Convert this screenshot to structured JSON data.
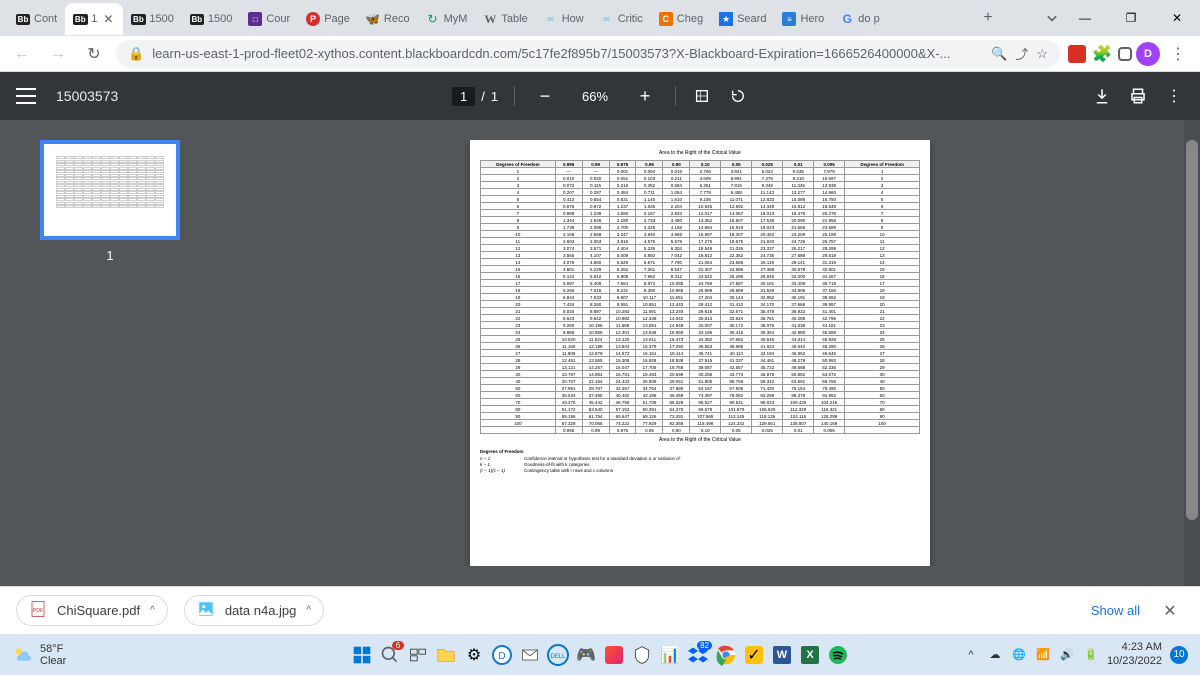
{
  "window": {
    "minimize": "—",
    "maximize": "❐",
    "close": "✕"
  },
  "tabs": {
    "items": [
      {
        "icon": "bb",
        "label": "Cont"
      },
      {
        "icon": "bb",
        "label": "1",
        "active": true,
        "closeable": true
      },
      {
        "icon": "bb",
        "label": "1500"
      },
      {
        "icon": "bb",
        "label": "1500"
      },
      {
        "icon": "quiz",
        "label": "Cour"
      },
      {
        "icon": "P",
        "label": "Page"
      },
      {
        "icon": "reco",
        "label": "Reco"
      },
      {
        "icon": "mym",
        "label": "MyM"
      },
      {
        "icon": "W",
        "label": "Table"
      },
      {
        "icon": "how",
        "label": "How"
      },
      {
        "icon": "how",
        "label": "Critic"
      },
      {
        "icon": "C",
        "label": "Cheg"
      },
      {
        "icon": "star",
        "label": "Seard"
      },
      {
        "icon": "hero",
        "label": "Hero"
      },
      {
        "icon": "G",
        "label": "do p"
      }
    ],
    "plus": "+"
  },
  "address": {
    "back": "←",
    "forward": "→",
    "reload": "↻",
    "lock": "🔒",
    "url": "learn-us-east-1-prod-fleet02-xythos.content.blackboardcdn.com/5c17fe2f895b7/15003573?X-Blackboard-Expiration=1666526400000&X-...",
    "search": "🔍",
    "share": "⇪",
    "star": "☆",
    "profile": "D",
    "menu": "⋮"
  },
  "pdf": {
    "title": "15003573",
    "page_current": "1",
    "page_sep": "/",
    "page_total": "1",
    "zoom_minus": "−",
    "zoom_value": "66%",
    "zoom_plus": "+",
    "download": "⬇",
    "print": "🖶",
    "more": "⋮"
  },
  "thumbnail": {
    "number": "1"
  },
  "chart_data": {
    "type": "table",
    "title": "Area to the Right of the Critical Value",
    "columns_left": "Degrees of Freedom",
    "columns_right": "Degrees of Freedom",
    "alpha": [
      "0.995",
      "0.99",
      "0.975",
      "0.95",
      "0.90",
      "0.10",
      "0.05",
      "0.025",
      "0.01",
      "0.005"
    ],
    "rows": [
      {
        "df": "1",
        "v": [
          "—",
          "—",
          "0.001",
          "0.004",
          "0.016",
          "2.706",
          "3.841",
          "5.024",
          "6.635",
          "7.879"
        ]
      },
      {
        "df": "2",
        "v": [
          "0.010",
          "0.020",
          "0.051",
          "0.103",
          "0.211",
          "4.605",
          "5.991",
          "7.378",
          "9.210",
          "10.597"
        ]
      },
      {
        "df": "3",
        "v": [
          "0.072",
          "0.115",
          "0.216",
          "0.352",
          "0.584",
          "6.251",
          "7.815",
          "9.348",
          "11.345",
          "12.838"
        ]
      },
      {
        "df": "4",
        "v": [
          "0.207",
          "0.297",
          "0.484",
          "0.711",
          "1.064",
          "7.779",
          "9.488",
          "11.143",
          "13.277",
          "14.860"
        ]
      },
      {
        "df": "5",
        "v": [
          "0.412",
          "0.554",
          "0.831",
          "1.145",
          "1.610",
          "9.236",
          "11.071",
          "12.833",
          "15.086",
          "16.750"
        ]
      },
      {
        "df": "6",
        "v": [
          "0.676",
          "0.872",
          "1.237",
          "1.635",
          "2.204",
          "10.645",
          "12.592",
          "14.449",
          "16.812",
          "18.548"
        ]
      },
      {
        "df": "7",
        "v": [
          "0.989",
          "1.239",
          "1.690",
          "2.167",
          "2.833",
          "12.017",
          "14.067",
          "16.013",
          "18.475",
          "20.278"
        ]
      },
      {
        "df": "8",
        "v": [
          "1.344",
          "1.646",
          "2.180",
          "2.733",
          "3.490",
          "13.362",
          "15.507",
          "17.535",
          "20.090",
          "21.955"
        ]
      },
      {
        "df": "9",
        "v": [
          "1.735",
          "2.088",
          "2.700",
          "3.325",
          "4.168",
          "14.684",
          "16.919",
          "19.023",
          "21.666",
          "23.589"
        ]
      },
      {
        "df": "10",
        "v": [
          "2.156",
          "2.558",
          "3.247",
          "3.940",
          "4.865",
          "15.987",
          "18.307",
          "20.483",
          "23.209",
          "25.188"
        ]
      },
      {
        "df": "11",
        "v": [
          "2.603",
          "3.053",
          "3.816",
          "4.575",
          "5.578",
          "17.275",
          "19.675",
          "21.920",
          "24.725",
          "26.757"
        ]
      },
      {
        "df": "12",
        "v": [
          "3.074",
          "3.571",
          "4.404",
          "5.226",
          "6.304",
          "18.549",
          "21.026",
          "23.337",
          "26.217",
          "28.299"
        ]
      },
      {
        "df": "13",
        "v": [
          "3.565",
          "4.107",
          "5.009",
          "5.892",
          "7.042",
          "19.812",
          "22.362",
          "24.736",
          "27.688",
          "29.819"
        ]
      },
      {
        "df": "14",
        "v": [
          "4.075",
          "4.660",
          "5.629",
          "6.571",
          "7.790",
          "21.064",
          "23.685",
          "26.119",
          "29.141",
          "31.319"
        ]
      },
      {
        "df": "15",
        "v": [
          "4.601",
          "5.229",
          "6.262",
          "7.261",
          "8.547",
          "22.307",
          "24.996",
          "27.488",
          "30.578",
          "32.801"
        ]
      },
      {
        "df": "16",
        "v": [
          "5.142",
          "5.812",
          "6.908",
          "7.962",
          "9.312",
          "23.542",
          "26.296",
          "28.845",
          "32.000",
          "34.267"
        ]
      },
      {
        "df": "17",
        "v": [
          "5.697",
          "6.408",
          "7.564",
          "8.672",
          "10.085",
          "24.769",
          "27.587",
          "30.191",
          "33.409",
          "35.718"
        ]
      },
      {
        "df": "18",
        "v": [
          "6.265",
          "7.015",
          "8.231",
          "9.390",
          "10.865",
          "25.989",
          "28.869",
          "31.526",
          "34.805",
          "37.156"
        ]
      },
      {
        "df": "19",
        "v": [
          "6.844",
          "7.633",
          "8.907",
          "10.117",
          "11.651",
          "27.204",
          "30.144",
          "32.852",
          "36.191",
          "38.582"
        ]
      },
      {
        "df": "20",
        "v": [
          "7.434",
          "8.260",
          "9.591",
          "10.851",
          "12.443",
          "28.412",
          "31.410",
          "34.170",
          "37.566",
          "39.997"
        ]
      },
      {
        "df": "21",
        "v": [
          "8.034",
          "8.897",
          "10.283",
          "11.591",
          "13.240",
          "29.615",
          "32.671",
          "35.479",
          "38.932",
          "41.401"
        ]
      },
      {
        "df": "22",
        "v": [
          "8.643",
          "9.542",
          "10.982",
          "12.338",
          "14.042",
          "30.813",
          "33.924",
          "36.781",
          "40.289",
          "42.796"
        ]
      },
      {
        "df": "23",
        "v": [
          "9.260",
          "10.196",
          "11.689",
          "13.091",
          "14.848",
          "32.007",
          "35.172",
          "38.076",
          "41.638",
          "44.181"
        ]
      },
      {
        "df": "24",
        "v": [
          "9.886",
          "10.856",
          "12.401",
          "13.848",
          "15.659",
          "33.196",
          "36.415",
          "39.364",
          "42.980",
          "45.559"
        ]
      },
      {
        "df": "25",
        "v": [
          "10.520",
          "11.524",
          "13.120",
          "14.611",
          "16.473",
          "34.382",
          "37.652",
          "40.646",
          "44.314",
          "46.928"
        ]
      },
      {
        "df": "26",
        "v": [
          "11.160",
          "12.198",
          "13.844",
          "15.379",
          "17.292",
          "35.563",
          "38.885",
          "41.923",
          "45.642",
          "48.290"
        ]
      },
      {
        "df": "27",
        "v": [
          "11.808",
          "12.879",
          "14.573",
          "16.151",
          "18.114",
          "36.741",
          "40.113",
          "43.194",
          "46.963",
          "49.645"
        ]
      },
      {
        "df": "28",
        "v": [
          "12.461",
          "13.565",
          "15.308",
          "16.928",
          "18.939",
          "37.916",
          "41.337",
          "44.461",
          "48.278",
          "50.993"
        ]
      },
      {
        "df": "29",
        "v": [
          "13.121",
          "14.257",
          "16.047",
          "17.708",
          "19.768",
          "39.087",
          "42.557",
          "45.722",
          "49.588",
          "52.336"
        ]
      },
      {
        "df": "30",
        "v": [
          "13.787",
          "14.954",
          "16.791",
          "18.493",
          "20.599",
          "40.256",
          "43.773",
          "46.979",
          "50.892",
          "53.672"
        ]
      },
      {
        "df": "40",
        "v": [
          "20.707",
          "22.164",
          "24.433",
          "26.509",
          "29.051",
          "51.805",
          "55.758",
          "59.342",
          "63.691",
          "66.766"
        ]
      },
      {
        "df": "50",
        "v": [
          "27.991",
          "29.707",
          "32.357",
          "34.764",
          "37.689",
          "63.167",
          "67.505",
          "71.420",
          "76.154",
          "79.490"
        ]
      },
      {
        "df": "60",
        "v": [
          "35.534",
          "37.485",
          "40.482",
          "43.188",
          "46.459",
          "74.397",
          "79.082",
          "83.298",
          "88.379",
          "91.952"
        ]
      },
      {
        "df": "70",
        "v": [
          "43.275",
          "45.442",
          "48.758",
          "51.739",
          "55.329",
          "85.527",
          "90.531",
          "95.023",
          "100.425",
          "104.215"
        ]
      },
      {
        "df": "80",
        "v": [
          "51.172",
          "53.540",
          "57.153",
          "60.391",
          "64.278",
          "96.578",
          "101.879",
          "106.629",
          "112.329",
          "116.321"
        ]
      },
      {
        "df": "90",
        "v": [
          "59.196",
          "61.754",
          "65.647",
          "69.126",
          "73.291",
          "107.565",
          "113.145",
          "118.136",
          "124.116",
          "128.299"
        ]
      },
      {
        "df": "100",
        "v": [
          "67.328",
          "70.065",
          "74.222",
          "77.929",
          "82.358",
          "118.498",
          "124.342",
          "129.561",
          "135.807",
          "140.169"
        ]
      }
    ],
    "footer_title": "Area to the Right of the Critical Value",
    "footnotes_header": "Degrees of Freedom",
    "footnotes": [
      {
        "label": "n − 1",
        "text": "Confidence interval or hypothesis test for a standard deviation σ or variance σ²"
      },
      {
        "label": "k − 1",
        "text": "Goodness-of-fit with k categories"
      },
      {
        "label": "(r − 1)(c − 1)",
        "text": "Contingency table with r rows and c columns"
      }
    ]
  },
  "downloads": {
    "items": [
      {
        "icon": "pdf",
        "name": "ChiSquare.pdf"
      },
      {
        "icon": "img",
        "name": "data n4a.jpg"
      }
    ],
    "show_all": "Show all",
    "close": "✕"
  },
  "taskbar": {
    "weather_temp": "58°F",
    "weather_cond": "Clear",
    "search_badge": "6",
    "dropbox_badge": "82",
    "time": "4:23 AM",
    "date": "10/23/2022",
    "notif_count": "10"
  }
}
